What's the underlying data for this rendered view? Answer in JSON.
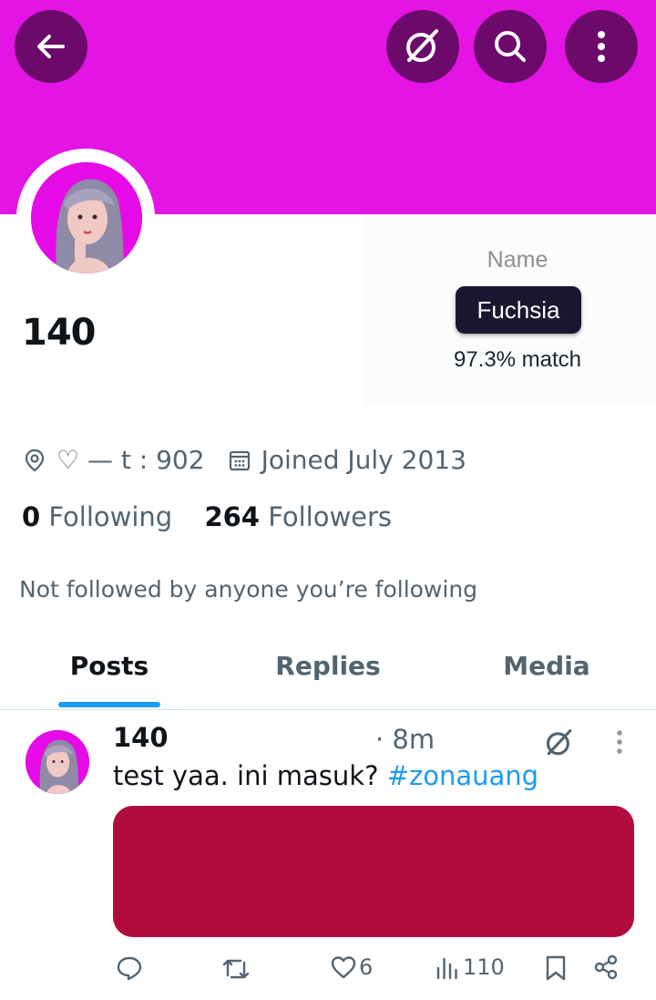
{
  "theme": {
    "banner_color": "#e415e4",
    "button_bg": "#6b0a6b",
    "accent": "#1d9bf0",
    "media_color": "#b20c3e"
  },
  "header": {
    "back_icon": "arrow-left-icon",
    "buttons": [
      "grok-icon",
      "search-icon",
      "more-vertical-icon"
    ]
  },
  "profile": {
    "display_name": "140",
    "location": "♡ — t : 902",
    "joined": "Joined July 2013",
    "following_count": "0",
    "following_label": "Following",
    "followers_count": "264",
    "followers_label": "Followers",
    "not_followed_text": "Not followed by anyone you’re following"
  },
  "color_card": {
    "label": "Name",
    "color_name": "Fuchsia",
    "match": "97.3% match"
  },
  "tabs": [
    {
      "label": "Posts",
      "active": true
    },
    {
      "label": "Replies",
      "active": false
    },
    {
      "label": "Media",
      "active": false
    }
  ],
  "post": {
    "name": "140",
    "time": "· 8m",
    "text": "test yaa. ini masuk? ",
    "hashtag": "#zonauang",
    "likes": "6",
    "views": "110"
  }
}
